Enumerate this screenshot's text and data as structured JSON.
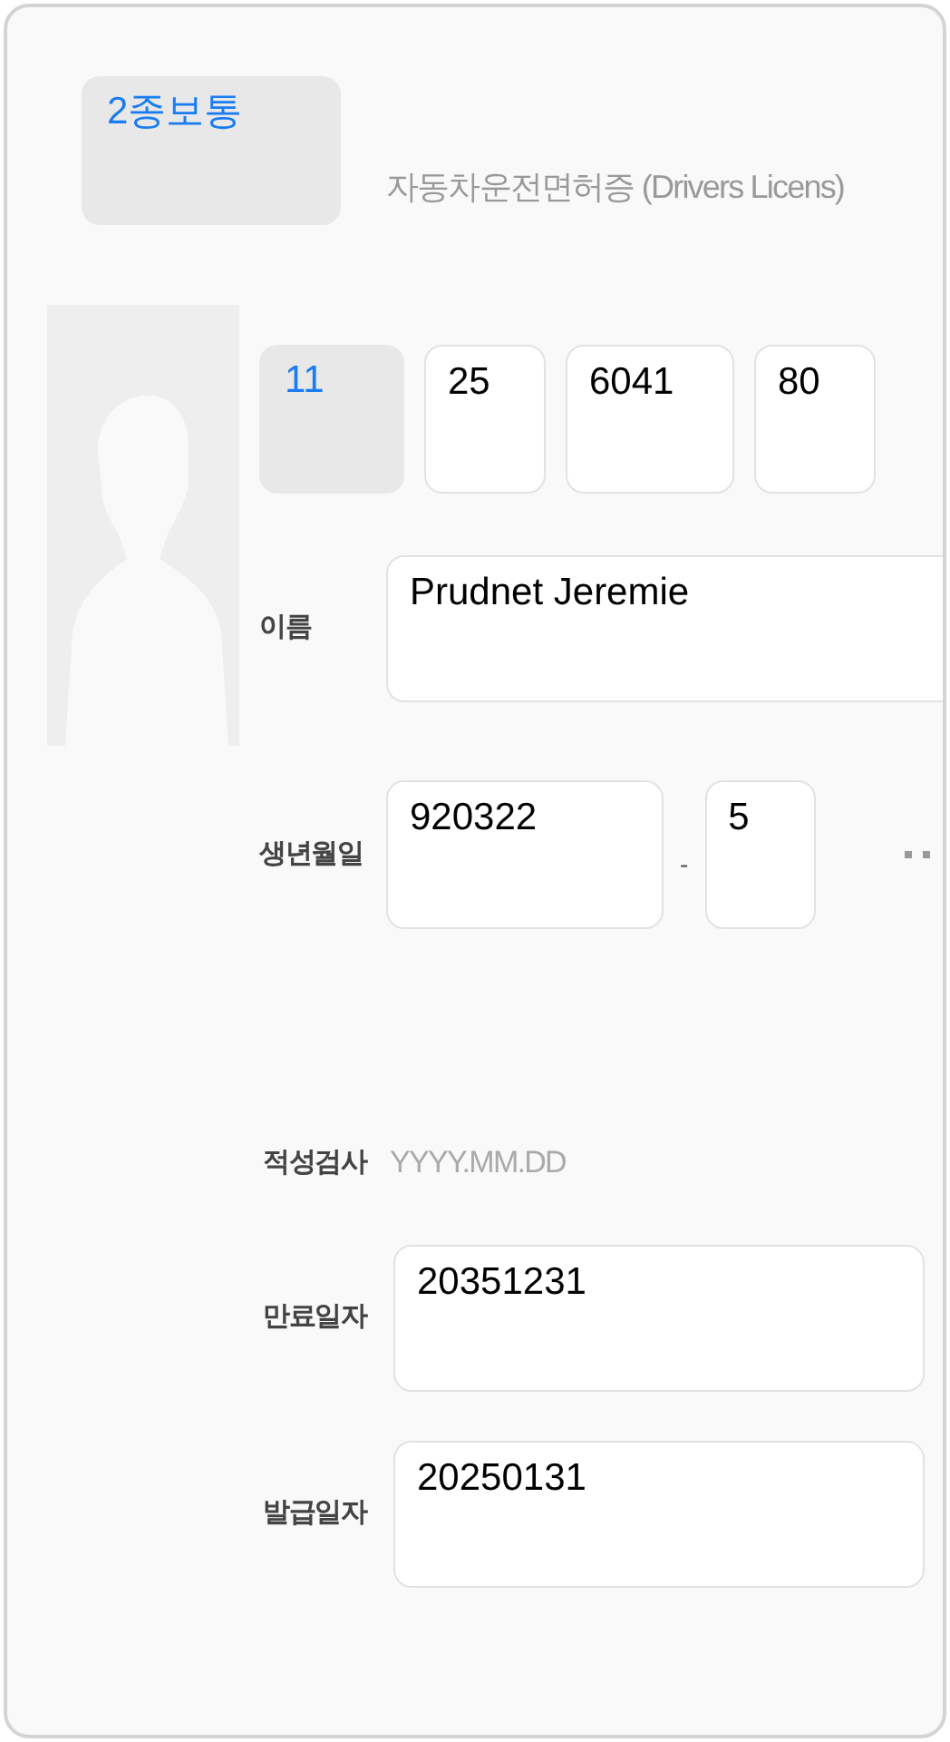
{
  "license_type": {
    "value": "2종보통"
  },
  "title": "자동차운전면허증 (Drivers Licens)",
  "license_number": [
    {
      "kind": "select",
      "value": "11"
    },
    {
      "kind": "input",
      "value": "25"
    },
    {
      "kind": "input",
      "value": "6041"
    },
    {
      "kind": "input",
      "value": "80"
    }
  ],
  "name": {
    "label": "이름",
    "value": "Prudnet Jeremie"
  },
  "birth": {
    "label": "생년월일",
    "value": "920322",
    "separator": "-",
    "suffix": "5"
  },
  "aptitude_test": {
    "label": "적성검사",
    "placeholder": "YYYY.MM.DD"
  },
  "expiry_date": {
    "label": "만료일자",
    "value": "20351231"
  },
  "issue_date": {
    "label": "발급일자",
    "value": "20250131"
  }
}
